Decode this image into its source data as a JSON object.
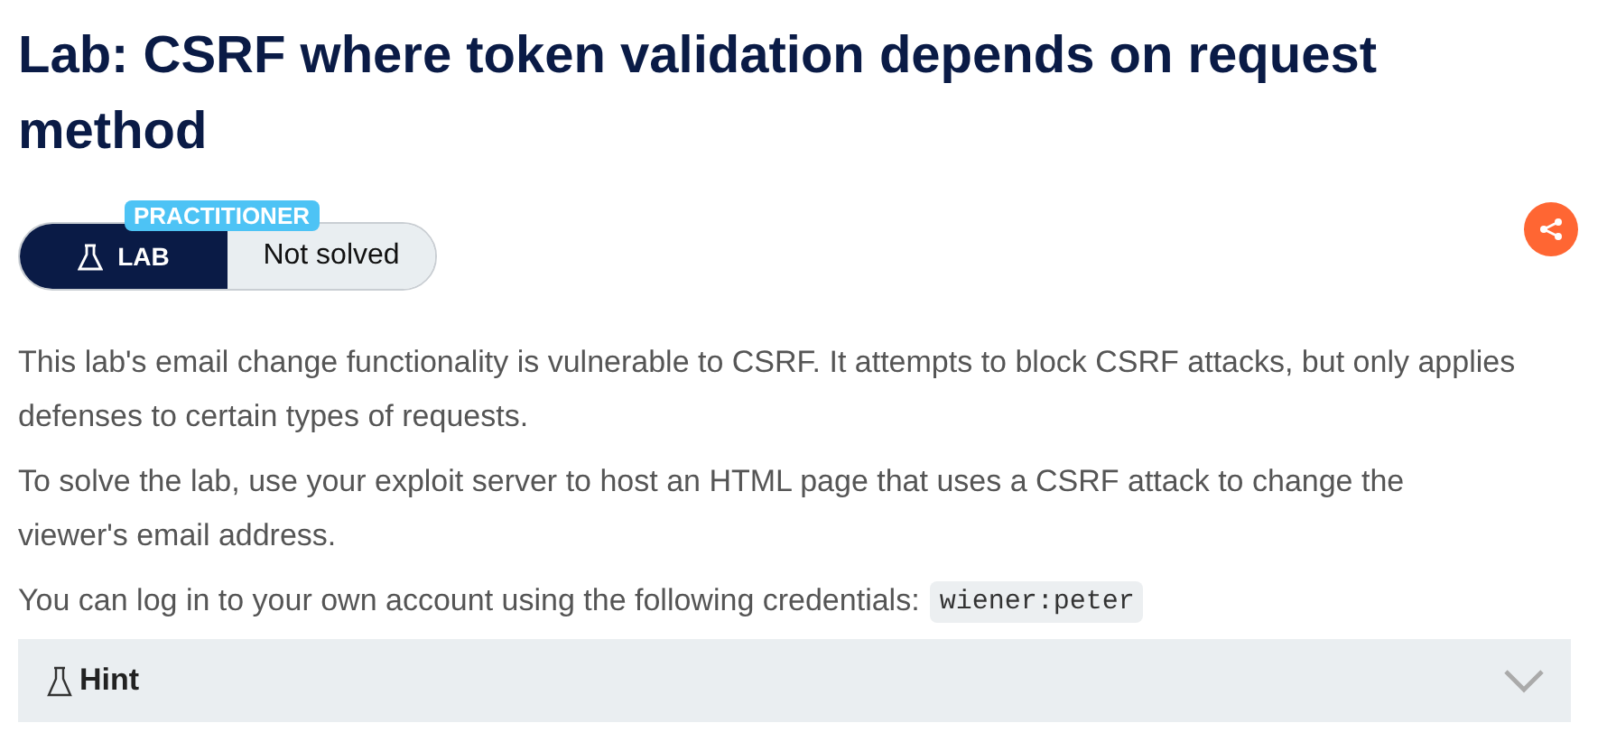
{
  "title": "Lab: CSRF where token validation depends on request method",
  "badge": {
    "level_label": "PRACTITIONER",
    "type_label": "LAB",
    "status": "Not solved",
    "solved": false
  },
  "paragraphs": [
    {
      "text": "This lab's email change functionality is vulnerable to CSRF. It attempts to block CSRF attacks, but only applies defenses to certain types of requests."
    },
    {
      "text": "To solve the lab, use your exploit server to host an HTML page that uses a CSRF attack to change the viewer's email address."
    },
    {
      "text": "You can log in to your own account using the following credentials:",
      "code": "wiener:peter"
    }
  ],
  "hint": {
    "label": "Hint",
    "expanded": false
  }
}
